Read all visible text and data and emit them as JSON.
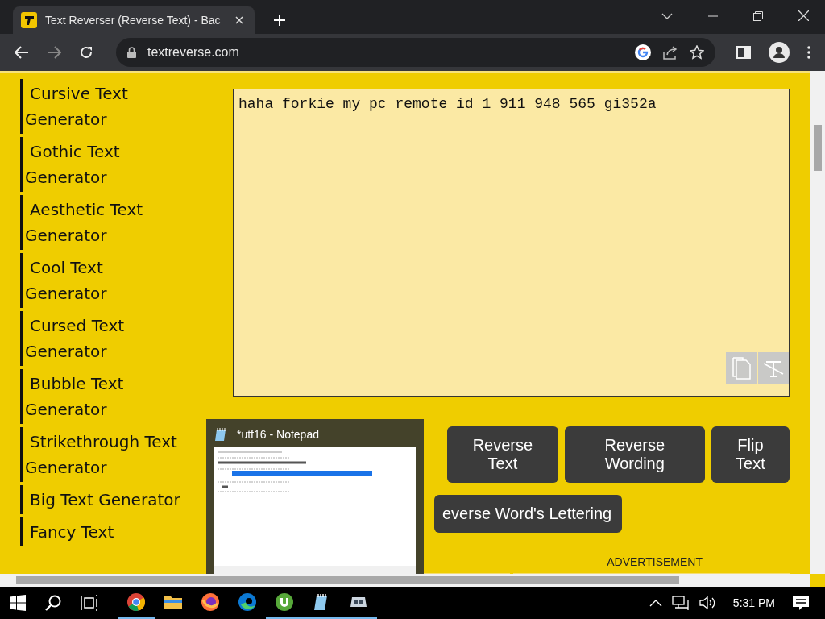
{
  "browser": {
    "tab": {
      "title": "Text Reverser (Reverse Text) - Bac"
    },
    "address": "textreverse.com"
  },
  "sidebar": {
    "items": [
      {
        "label": "Cursive Text Generator"
      },
      {
        "label": "Gothic Text Generator"
      },
      {
        "label": "Aesthetic Text Generator"
      },
      {
        "label": "Cool Text Generator"
      },
      {
        "label": "Cursed Text Generator"
      },
      {
        "label": "Bubble Text Generator"
      },
      {
        "label": "Strikethrough Text Generator"
      },
      {
        "label": "Big Text Generator"
      },
      {
        "label": "Fancy Text"
      }
    ]
  },
  "editor": {
    "value": "haha forkie my pc remote id 1 911 948 565 gi352a"
  },
  "buttons": [
    [
      "Reverse Text",
      "Reverse Wording",
      "Flip Text"
    ],
    [
      "everse Word's Lettering"
    ]
  ],
  "advertisement": "ADVERTISEMENT",
  "preview": {
    "title": "*utf16 - Notepad"
  },
  "taskbar": {
    "apps": [
      {
        "kind": "chrome",
        "running": true
      },
      {
        "kind": "folder",
        "running": false
      },
      {
        "kind": "firefox",
        "running": false
      },
      {
        "kind": "edge",
        "running": false
      },
      {
        "kind": "torrent",
        "running": true
      },
      {
        "kind": "notepad",
        "running": true
      },
      {
        "kind": "app",
        "running": true
      }
    ],
    "clock": "5:31 PM"
  }
}
